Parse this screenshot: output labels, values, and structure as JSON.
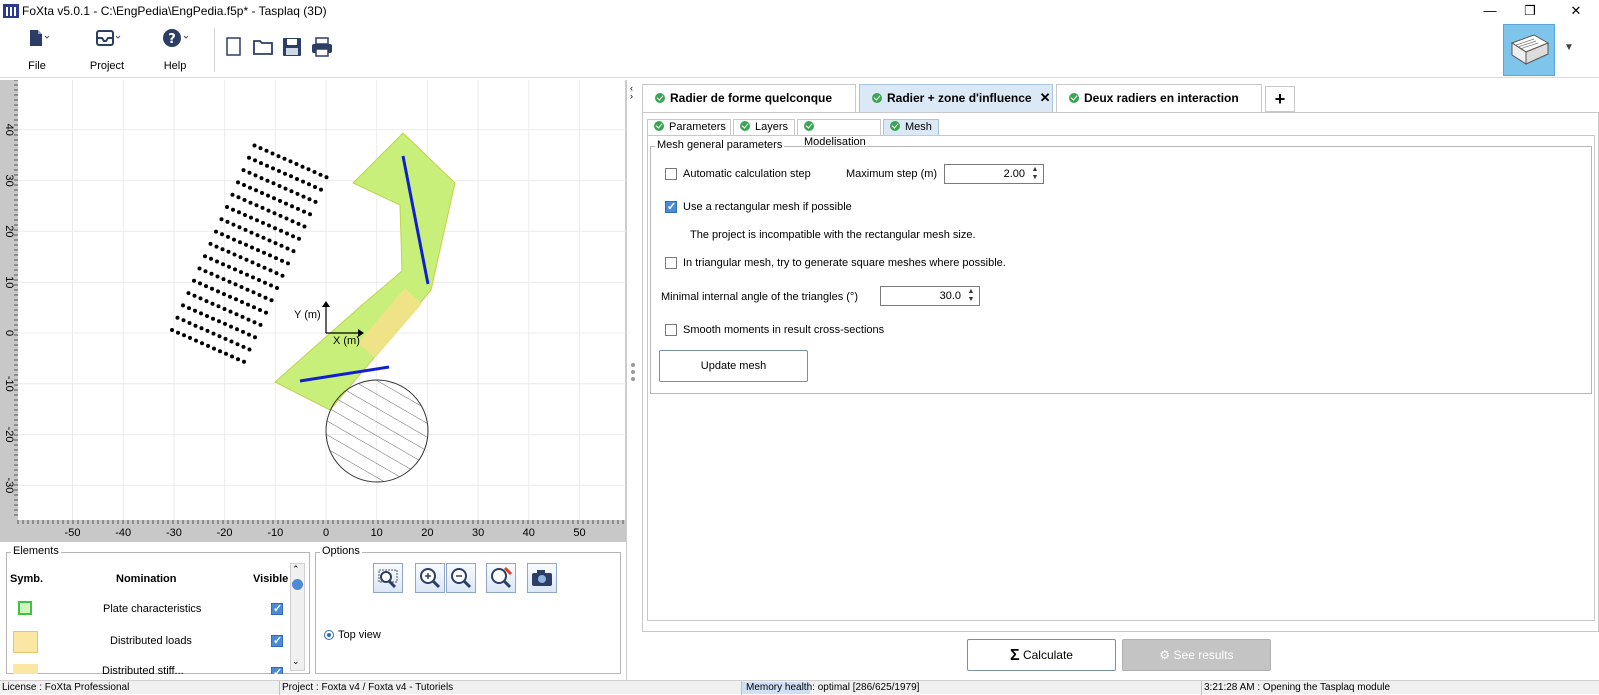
{
  "window": {
    "title": "FoXta v5.0.1 - C:\\EngPedia\\EngPedia.f5p* - Tasplaq (3D)",
    "controls": [
      "—",
      "❐",
      "✕"
    ]
  },
  "ribbon": {
    "file_label": "File",
    "project_label": "Project",
    "help_label": "Help"
  },
  "canvas": {
    "x_ticks": [
      "-50",
      "-40",
      "-30",
      "-20",
      "-10",
      "0",
      "10",
      "20",
      "30",
      "40",
      "50"
    ],
    "y_ticks": [
      "40",
      "30",
      "20",
      "10",
      "0",
      "-10",
      "-20",
      "-30"
    ],
    "x_axis_label": "X (m)",
    "y_axis_label": "Y (m)",
    "colors": {
      "plate": "#c8ef7a",
      "load": "#f5e08a",
      "beam": "#1020d0"
    }
  },
  "elements": {
    "title": "Elements",
    "headers": {
      "symb": "Symb.",
      "nomination": "Nomination",
      "visible": "Visible"
    },
    "rows": [
      {
        "name": "Plate characteristics",
        "visible": true
      },
      {
        "name": "Distributed loads",
        "visible": true
      },
      {
        "name": "Distributed stiff...",
        "visible": true
      }
    ]
  },
  "options": {
    "title": "Options",
    "view_label": "Top view"
  },
  "tabs": [
    {
      "label": "Radier de forme quelconque",
      "active": false,
      "closable": false
    },
    {
      "label": "Radier + zone d'influence",
      "active": true,
      "closable": true
    },
    {
      "label": "Deux radiers en interaction",
      "active": false,
      "closable": false
    }
  ],
  "subtabs": [
    {
      "label": "Parameters",
      "active": false
    },
    {
      "label": "Layers",
      "active": false
    },
    {
      "label": "Modelisation",
      "active": false
    },
    {
      "label": "Mesh",
      "active": true
    }
  ],
  "mesh": {
    "group_title": "Mesh general parameters",
    "auto_step_label": "Automatic calculation step",
    "auto_step_checked": false,
    "max_step_label": "Maximum step (m)",
    "max_step_value": "2.00",
    "rect_mesh_label": "Use a rectangular mesh if possible",
    "rect_mesh_checked": true,
    "incompatible_msg": "The project is incompatible with the rectangular mesh size.",
    "square_mesh_label": "In triangular mesh, try to generate square meshes where possible.",
    "square_mesh_checked": false,
    "min_angle_label": "Minimal internal angle of the triangles (°)",
    "min_angle_value": "30.0",
    "smooth_label": "Smooth moments in result cross-sections",
    "smooth_checked": false,
    "update_button": "Update mesh"
  },
  "actions": {
    "calculate": "Calculate",
    "see_results": "See results"
  },
  "status": {
    "license": "License : FoXta Professional",
    "project": "Project : Foxta v4 / Foxta v4 - Tutoriels",
    "memory": "Memory health: optimal [286/625/1979]",
    "log": "3:21:28 AM : Opening the Tasplaq module"
  }
}
